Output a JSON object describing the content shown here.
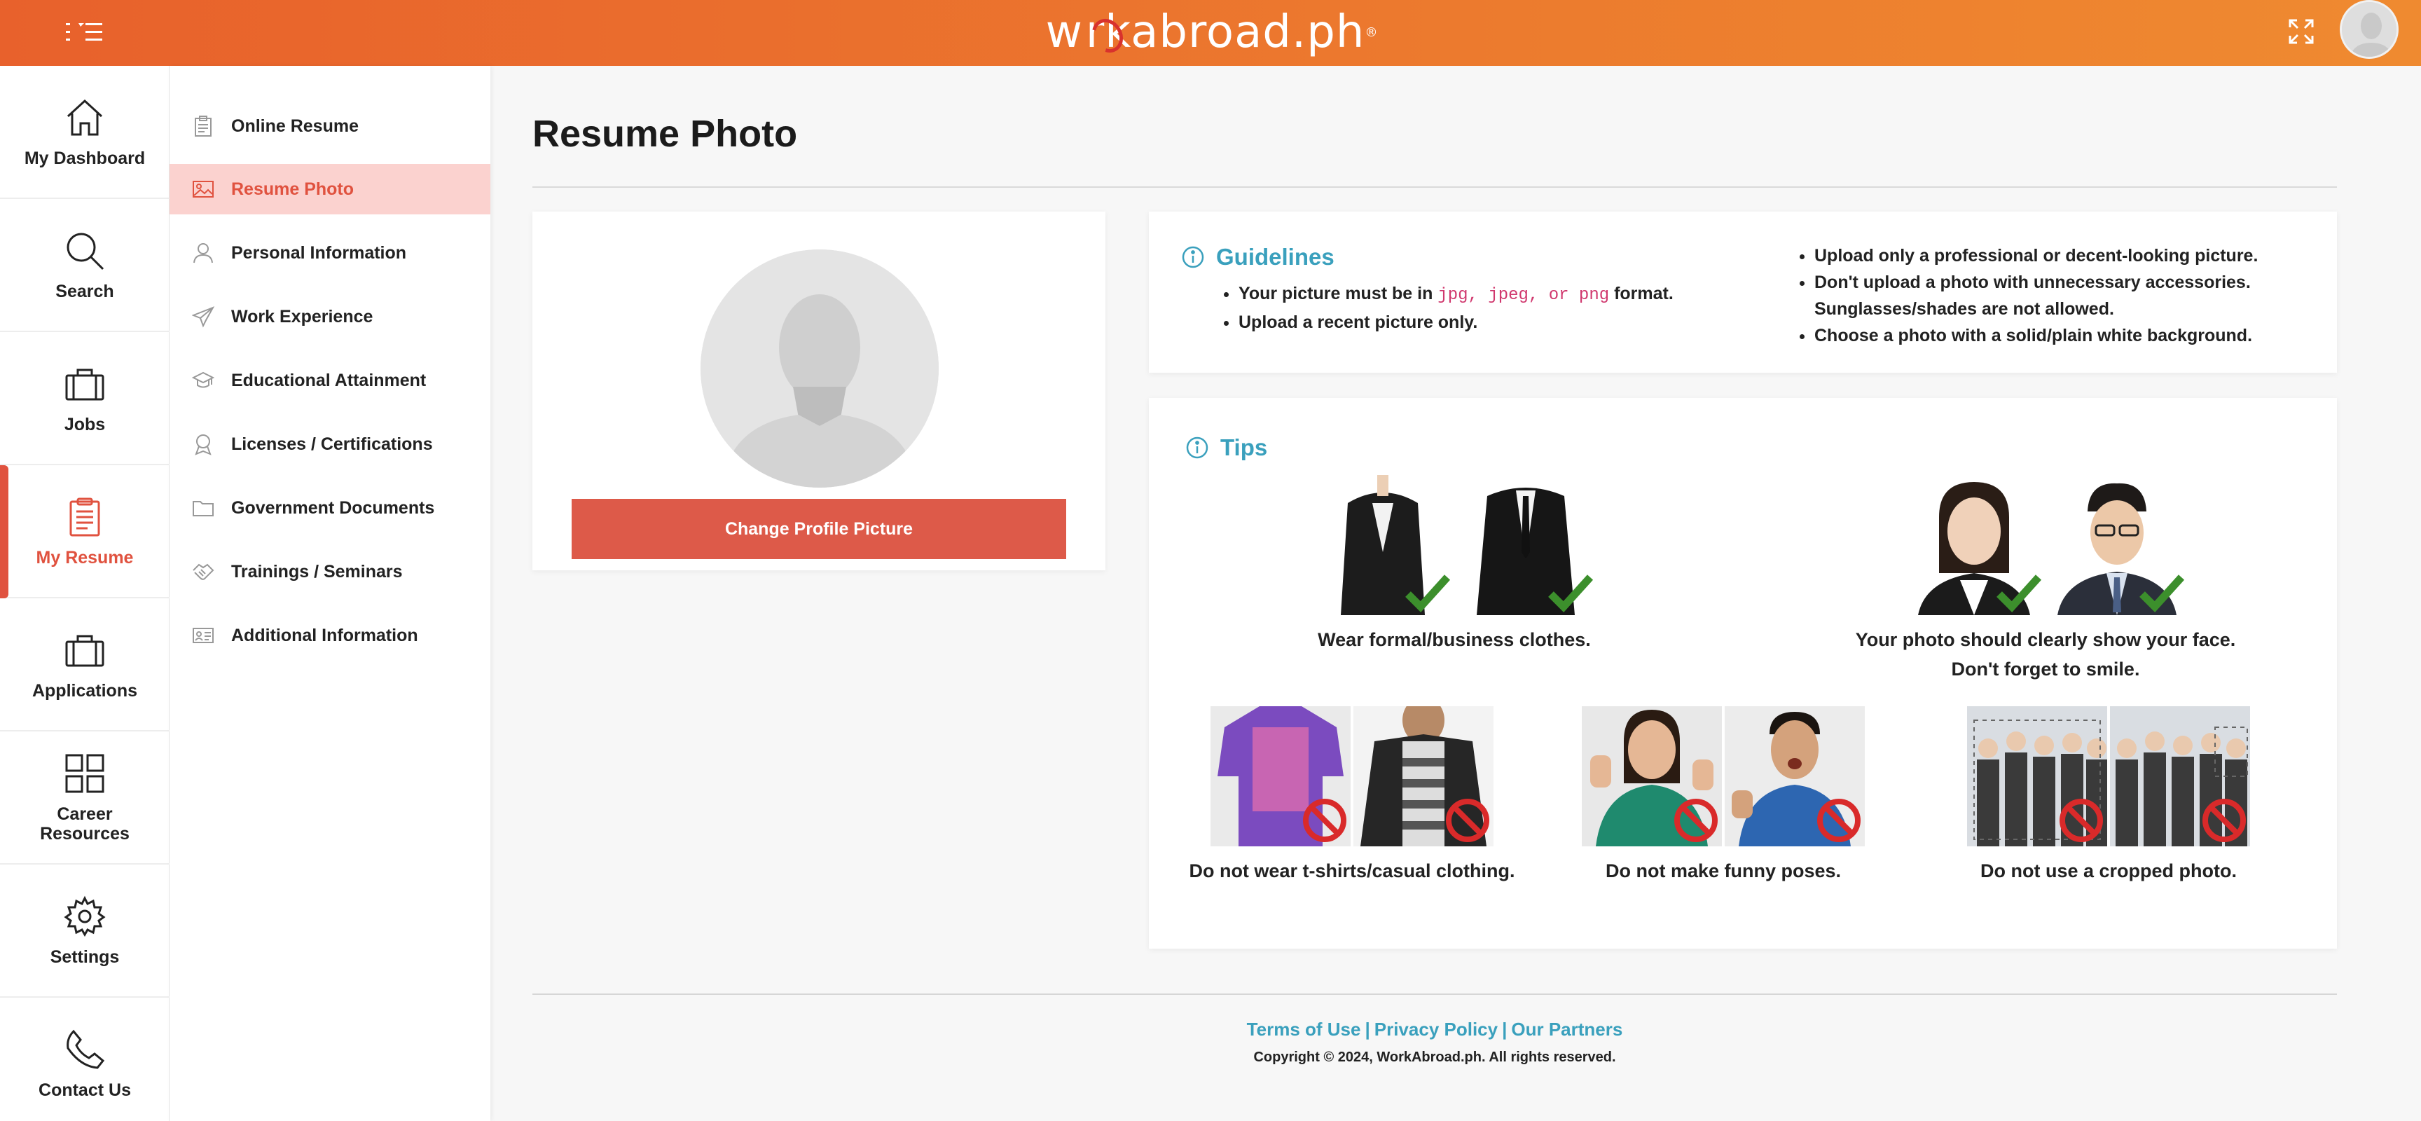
{
  "brand": {
    "logo_pre": "w",
    "logo_post": "rkabroad.ph",
    "logo_mark": "®",
    "accent": "#e8612c",
    "active": "#e0523f",
    "link": "#3aa0bd"
  },
  "rail": [
    {
      "label": "My Dashboard",
      "icon": "home-icon"
    },
    {
      "label": "Search",
      "icon": "search-icon"
    },
    {
      "label": "Jobs",
      "icon": "briefcase-icon"
    },
    {
      "label": "My Resume",
      "icon": "resume-icon",
      "active": true
    },
    {
      "label": "Applications",
      "icon": "briefcase-icon"
    },
    {
      "label": "Career Resources",
      "icon": "grid-icon"
    },
    {
      "label": "Settings",
      "icon": "gear-icon"
    },
    {
      "label": "Contact Us",
      "icon": "phone-icon"
    }
  ],
  "subnav": [
    {
      "label": "Online Resume",
      "icon": "clipboard-icon"
    },
    {
      "label": "Resume Photo",
      "icon": "image-icon",
      "active": true
    },
    {
      "label": "Personal Information",
      "icon": "person-icon"
    },
    {
      "label": "Work Experience",
      "icon": "plane-icon"
    },
    {
      "label": "Educational Attainment",
      "icon": "graduation-cap-icon"
    },
    {
      "label": "Licenses / Certifications",
      "icon": "award-icon"
    },
    {
      "label": "Government Documents",
      "icon": "folder-icon"
    },
    {
      "label": "Trainings / Seminars",
      "icon": "handshake-icon"
    },
    {
      "label": "Additional Information",
      "icon": "id-card-icon"
    }
  ],
  "main": {
    "title": "Resume Photo",
    "change_button": "Change Profile Picture",
    "guidelines": {
      "heading": "Guidelines",
      "left": {
        "item1_pre": "Your picture must be in ",
        "item1_code": "jpg, jpeg, or png",
        "item1_post": " format.",
        "item2": "Upload a recent picture only."
      },
      "right": [
        "Upload only a professional or decent-looking picture.",
        "Don't upload a photo with unnecessary accessories.",
        "Sunglasses/shades are not allowed.",
        "Choose a photo with a solid/plain white background."
      ]
    },
    "tips": {
      "heading": "Tips",
      "items": [
        {
          "caption": "Wear formal/business clothes.",
          "caption2": "",
          "ok": true
        },
        {
          "caption": "Your photo should clearly show your face.",
          "caption2": "Don't forget to smile.",
          "ok": true
        },
        {
          "caption": "Do not wear t-shirts/casual clothing.",
          "caption2": "",
          "ok": false
        },
        {
          "caption": "Do not make funny poses.",
          "caption2": "",
          "ok": false
        },
        {
          "caption": "Do not use a cropped photo.",
          "caption2": "",
          "ok": false
        }
      ]
    }
  },
  "footer": {
    "terms": "Terms of Use",
    "privacy": "Privacy Policy",
    "partners": "Our Partners",
    "sep": "|",
    "copyright": "Copyright © 2024, WorkAbroad.ph. All rights reserved."
  }
}
